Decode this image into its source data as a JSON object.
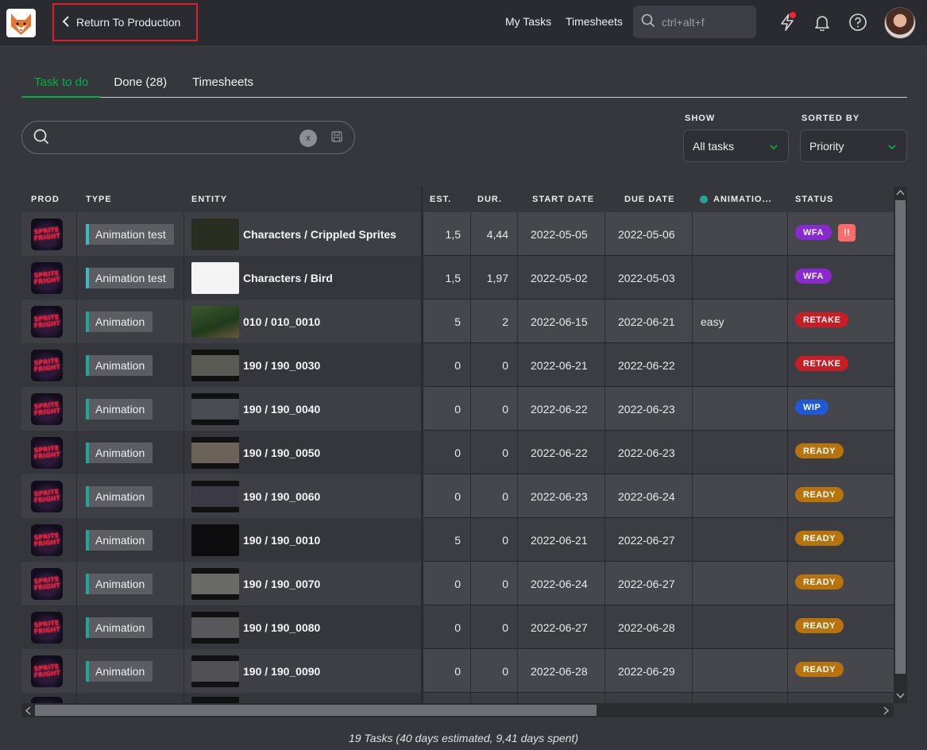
{
  "header": {
    "back_label": "Return To Production",
    "nav": {
      "my_tasks": "My Tasks",
      "timesheets": "Timesheets"
    },
    "search_placeholder": "ctrl+alt+f"
  },
  "tabs": [
    {
      "label": "Task to do",
      "active": true
    },
    {
      "label": "Done (28)",
      "active": false
    },
    {
      "label": "Timesheets",
      "active": false
    }
  ],
  "search": {
    "value": "",
    "clear_label": "x"
  },
  "filters": {
    "show_label": "SHOW",
    "show_value": "All tasks",
    "sorted_label": "SORTED BY",
    "sorted_value": "Priority"
  },
  "table": {
    "headers": {
      "prod": "PROD",
      "type": "TYPE",
      "entity": "ENTITY",
      "est": "EST.",
      "dur": "DUR.",
      "start": "START DATE",
      "due": "DUE DATE",
      "anim": "ANIMATIO...",
      "status": "STATUS"
    },
    "anim_column_color": "#22a59a",
    "rows": [
      {
        "prod": "SPRITE FRIGHT",
        "type": "Animation test",
        "entity": "Characters / Crippled Sprites",
        "est": "1,5",
        "dur": "4,44",
        "start": "2022-05-05",
        "due": "2022-05-06",
        "anim": "",
        "status": "WFA",
        "status_color": "#8a28d1",
        "priority": "!!"
      },
      {
        "prod": "SPRITE FRIGHT",
        "type": "Animation test",
        "entity": "Characters / Bird",
        "est": "1,5",
        "dur": "1,97",
        "start": "2022-05-02",
        "due": "2022-05-03",
        "anim": "",
        "status": "WFA",
        "status_color": "#8a28d1",
        "priority": ""
      },
      {
        "prod": "SPRITE FRIGHT",
        "type": "Animation",
        "entity": "010 / 010_0010",
        "est": "5",
        "dur": "2",
        "start": "2022-06-15",
        "due": "2022-06-21",
        "anim": "easy",
        "status": "RETAKE",
        "status_color": "#c81d25",
        "priority": ""
      },
      {
        "prod": "SPRITE FRIGHT",
        "type": "Animation",
        "entity": "190 / 190_0030",
        "est": "0",
        "dur": "0",
        "start": "2022-06-21",
        "due": "2022-06-22",
        "anim": "",
        "status": "RETAKE",
        "status_color": "#c81d25",
        "priority": ""
      },
      {
        "prod": "SPRITE FRIGHT",
        "type": "Animation",
        "entity": "190 / 190_0040",
        "est": "0",
        "dur": "0",
        "start": "2022-06-22",
        "due": "2022-06-23",
        "anim": "",
        "status": "WIP",
        "status_color": "#1e5ad6",
        "priority": ""
      },
      {
        "prod": "SPRITE FRIGHT",
        "type": "Animation",
        "entity": "190 / 190_0050",
        "est": "0",
        "dur": "0",
        "start": "2022-06-22",
        "due": "2022-06-23",
        "anim": "",
        "status": "READY",
        "status_color": "#b8730d",
        "priority": ""
      },
      {
        "prod": "SPRITE FRIGHT",
        "type": "Animation",
        "entity": "190 / 190_0060",
        "est": "0",
        "dur": "0",
        "start": "2022-06-23",
        "due": "2022-06-24",
        "anim": "",
        "status": "READY",
        "status_color": "#b8730d",
        "priority": ""
      },
      {
        "prod": "SPRITE FRIGHT",
        "type": "Animation",
        "entity": "190 / 190_0010",
        "est": "5",
        "dur": "0",
        "start": "2022-06-21",
        "due": "2022-06-27",
        "anim": "",
        "status": "READY",
        "status_color": "#b8730d",
        "priority": ""
      },
      {
        "prod": "SPRITE FRIGHT",
        "type": "Animation",
        "entity": "190 / 190_0070",
        "est": "0",
        "dur": "0",
        "start": "2022-06-24",
        "due": "2022-06-27",
        "anim": "",
        "status": "READY",
        "status_color": "#b8730d",
        "priority": ""
      },
      {
        "prod": "SPRITE FRIGHT",
        "type": "Animation",
        "entity": "190 / 190_0080",
        "est": "0",
        "dur": "0",
        "start": "2022-06-27",
        "due": "2022-06-28",
        "anim": "",
        "status": "READY",
        "status_color": "#b8730d",
        "priority": ""
      },
      {
        "prod": "SPRITE FRIGHT",
        "type": "Animation",
        "entity": "190 / 190_0090",
        "est": "0",
        "dur": "0",
        "start": "2022-06-28",
        "due": "2022-06-29",
        "anim": "",
        "status": "READY",
        "status_color": "#b8730d",
        "priority": ""
      }
    ]
  },
  "footer": "19 Tasks (40 days estimated, 9,41 days spent)"
}
